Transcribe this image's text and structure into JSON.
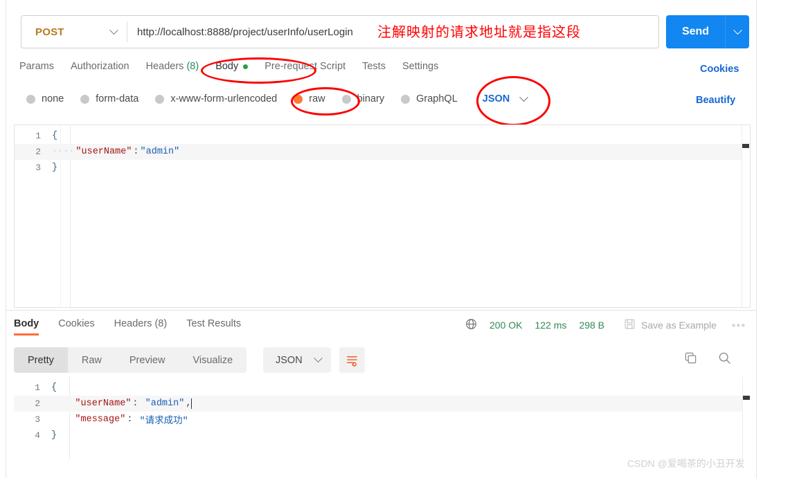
{
  "request": {
    "method": "POST",
    "url": "http://localhost:8888/project/userInfo/userLogin",
    "send_label": "Send",
    "annotation": "注解映射的请求地址就是指这段",
    "tabs": [
      {
        "label": "Params",
        "active": false
      },
      {
        "label": "Authorization",
        "active": false
      },
      {
        "label": "Headers",
        "count": "(8)",
        "active": false
      },
      {
        "label": "Body",
        "active": true,
        "dot": true
      },
      {
        "label": "Pre-request Script",
        "active": false
      },
      {
        "label": "Tests",
        "active": false
      },
      {
        "label": "Settings",
        "active": false
      }
    ],
    "cookies_link": "Cookies",
    "beautify_link": "Beautify",
    "body_types": [
      {
        "label": "none",
        "selected": false
      },
      {
        "label": "form-data",
        "selected": false
      },
      {
        "label": "x-www-form-urlencoded",
        "selected": false
      },
      {
        "label": "raw",
        "selected": true
      },
      {
        "label": "binary",
        "selected": false
      },
      {
        "label": "GraphQL",
        "selected": false
      }
    ],
    "raw_format": "JSON",
    "body_lines": [
      {
        "n": "1",
        "fold": "{",
        "text": ""
      },
      {
        "n": "2",
        "fold": "",
        "indent": "····",
        "key": "\"userName\"",
        "colon": ":",
        "value": "\"admin\"",
        "highlight": true
      },
      {
        "n": "3",
        "fold": "}",
        "text": ""
      }
    ]
  },
  "response": {
    "tabs": [
      {
        "label": "Body",
        "active": true
      },
      {
        "label": "Cookies",
        "active": false
      },
      {
        "label": "Headers (8)",
        "active": false
      },
      {
        "label": "Test Results",
        "active": false
      }
    ],
    "status": "200 OK",
    "time": "122 ms",
    "size": "298 B",
    "save_as_example": "Save as Example",
    "more": "◦◦◦",
    "format_buttons": [
      {
        "label": "Pretty",
        "active": true
      },
      {
        "label": "Raw",
        "active": false
      },
      {
        "label": "Preview",
        "active": false
      },
      {
        "label": "Visualize",
        "active": false
      }
    ],
    "format_type": "JSON",
    "body_lines": [
      {
        "n": "1",
        "fold": "{",
        "text": ""
      },
      {
        "n": "2",
        "fold": "",
        "indent": "    ",
        "key": "\"userName\"",
        "colon": ": ",
        "value": "\"admin\"",
        "trail": ",",
        "highlight": true
      },
      {
        "n": "3",
        "fold": "",
        "indent": "    ",
        "key": "\"message\"",
        "colon": ": ",
        "value": "\"请求成功\"",
        "trail": ""
      },
      {
        "n": "4",
        "fold": "}",
        "text": ""
      }
    ]
  },
  "watermark": "CSDN @爱喝茶的小丑开发",
  "colors": {
    "send_blue": "#1286f1",
    "link_blue": "#1667d1",
    "method_amber": "#b7791f",
    "accent_orange": "#ff6c37",
    "raw_orange": "#ff7a33",
    "status_green": "#2e8b57",
    "annotation_red": "#ff0000"
  }
}
